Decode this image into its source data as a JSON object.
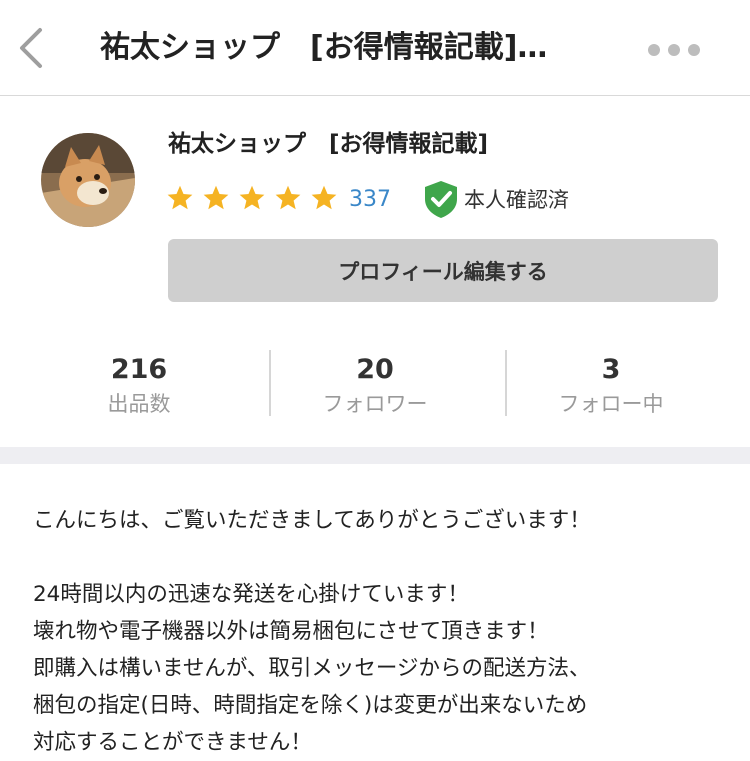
{
  "header": {
    "title": "祐太ショップ　[お得情報記載]…"
  },
  "profile": {
    "name": "祐太ショップ　[お得情報記載]",
    "rating": 5,
    "rating_count": "337",
    "verified_label": "本人確認済",
    "edit_button_label": "プロフィール編集する",
    "avatar_icon": "shiba-dog-avatar"
  },
  "stats": [
    {
      "value": "216",
      "label": "出品数"
    },
    {
      "value": "20",
      "label": "フォロワー"
    },
    {
      "value": "3",
      "label": "フォロー中"
    }
  ],
  "description": [
    "こんにちは、ご覧いただきましてありがとうございます！",
    "",
    "24時間以内の迅速な発送を心掛けています！",
    "壊れ物や電子機器以外は簡易梱包にさせて頂きます！",
    "即購入は構いませんが、取引メッセージからの配送方法、",
    "梱包の指定(日時、時間指定を除く)は変更が出来ないため",
    "対応することができません！"
  ],
  "colors": {
    "rating_count": "#3a87c8",
    "verified_green": "#3fa64b",
    "star": "#f5b323",
    "edit_button_bg": "#cfcfcf",
    "band": "#eeeef2"
  }
}
